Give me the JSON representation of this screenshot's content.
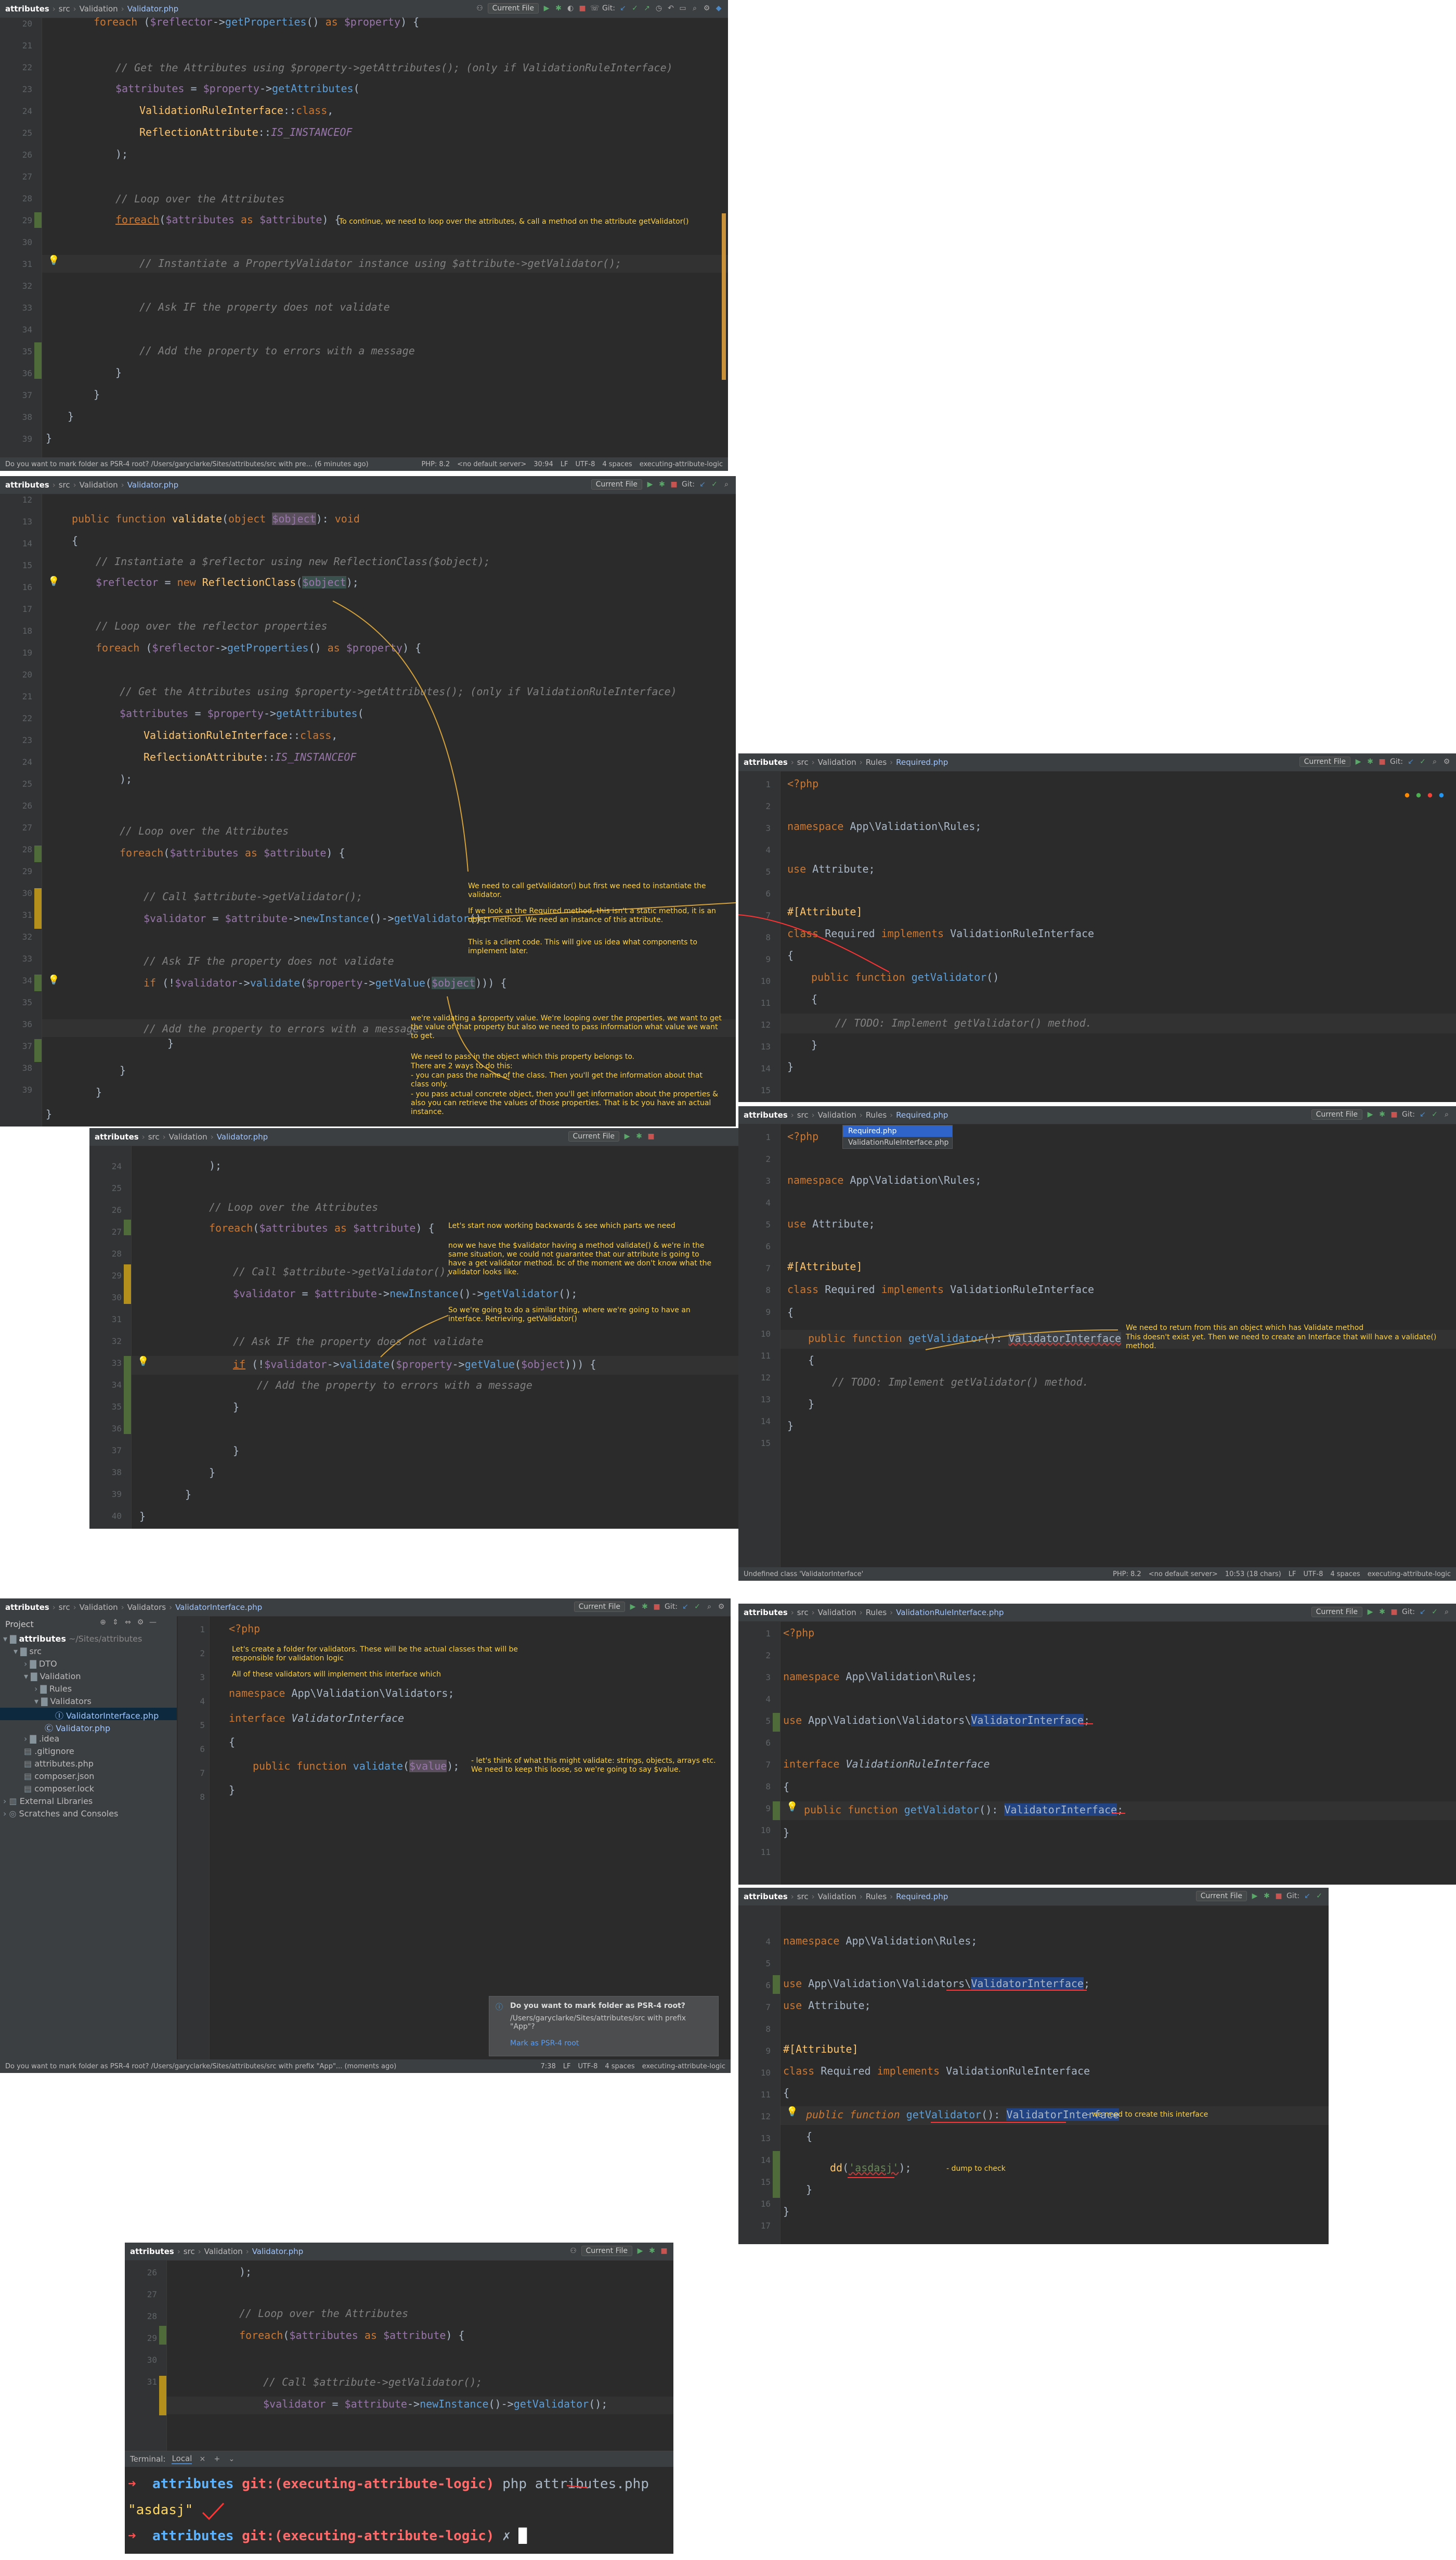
{
  "common": {
    "project": "attributes",
    "src": "src",
    "validation": "Validation",
    "rules": "Rules",
    "validators": "Validators",
    "validator_file": "Validator.php",
    "required_file": "Required.php",
    "vri_file": "ValidationRuleInterface.php",
    "vi_file": "ValidatorInterface.php",
    "run_config": "Current File",
    "git": "Git:",
    "php_version": "PHP: 8.2",
    "servers": "<no default server>",
    "lf": "LF",
    "encoding": "UTF-8",
    "indent": "4 spaces",
    "branch": "executing-attribute-logic"
  },
  "panel1": {
    "lines": [
      "20",
      "21",
      "22",
      "23",
      "24",
      "25",
      "26",
      "27",
      "28",
      "29",
      "30",
      "31",
      "32",
      "33",
      "34",
      "35",
      "36",
      "37",
      "38",
      "39"
    ],
    "note": "To continue, we need to loop over the attributes, & call a method on the attribute getValidator()",
    "status": "Do you want to mark folder as PSR-4 root? /Users/garyclarke/Sites/attributes/src with pre... (6 minutes ago)",
    "pos": "30:94"
  },
  "panel2": {
    "lines": [
      "12",
      "13",
      "14",
      "15",
      "16",
      "17",
      "18",
      "19",
      "20",
      "21",
      "22",
      "23",
      "24",
      "25",
      "26",
      "27",
      "28",
      "29",
      "30",
      "31",
      "32",
      "33",
      "34",
      "35",
      "36",
      "37",
      "38",
      "39"
    ],
    "note1": "We need to call getValidator() but first we need to instantiate the validator.",
    "note2": "If we look at the Required method, this isn't a static method, it is an object method. We need an instance of this attribute.",
    "note3": "This is a client code. This will give us idea what components to implement later.",
    "note4": "we're validating a $property value. We're looping over the properties, we want to get the value of that property but also we need to pass information what value we want to get.",
    "note5": "We need to pass in the object which this property belongs to.",
    "note6": "There are 2 ways to do this:",
    "note7": "- you can pass the name of the class. Then you'll get the information about that class only.",
    "note8": "- you pass actual concrete object, then you'll get information about the properties & also you can retrieve the values of those properties. That is bc you have an actual instance."
  },
  "panel3": {
    "lines": [
      "1",
      "2",
      "3",
      "4",
      "5",
      "6",
      "7",
      "8",
      "9",
      "10",
      "11",
      "12",
      "13",
      "14",
      "15"
    ],
    "status_dummy": ""
  },
  "panel4": {
    "lines": [
      "24",
      "25",
      "26",
      "27",
      "28",
      "29",
      "30",
      "31",
      "32",
      "33",
      "34",
      "35",
      "36",
      "37",
      "38",
      "39",
      "40"
    ],
    "note1": "Let's start now working backwards & see which parts we need",
    "note2": "now we have the $validator having a method validate() & we're in the same situation, we could not guarantee that our attribute is going to have a get validator method. bc of the moment we don't know what the validator looks like.",
    "note3": "So we're going to do a similar thing, where we're going to have an interface. Retrieving, getValidator()"
  },
  "panel5": {
    "lines": [
      "1",
      "2",
      "3",
      "4",
      "5",
      "6",
      "7",
      "8",
      "9",
      "10",
      "11",
      "12",
      "13",
      "14",
      "15"
    ],
    "dd1": "Required.php",
    "dd2": "ValidationRuleInterface.php",
    "note1": "We need to return from this an object which has Validate method",
    "note2": "This doesn't exist yet. Then we need to create an Interface that will have a validate() method.",
    "status": "Undefined class 'ValidatorInterface'",
    "pos": "10:53 (18 chars)"
  },
  "panel6": {
    "lines": [
      "1",
      "2",
      "3",
      "4",
      "5",
      "6",
      "7",
      "8"
    ],
    "project_title": "Project",
    "tree": {
      "root": "attributes",
      "root_path": "~/Sites/attributes",
      "src": "src",
      "dto": "DTO",
      "validation": "Validation",
      "rules": "Rules",
      "validators": "Validators",
      "vi": "ValidatorInterface.php",
      "validator": "Validator.php",
      "idea": ".idea",
      "gitignore": ".gitignore",
      "attributes_php": "attributes.php",
      "composer_json": "composer.json",
      "composer_lock": "composer.lock",
      "ext": "External Libraries",
      "scratch": "Scratches and Consoles"
    },
    "note1": "Let's create a folder for validators. These will be the actual classes that will be responsible for validation logic",
    "note2": "All of these validators will implement this interface which",
    "note3": "- let's think of what this might validate: strings, objects, arrays etc. We need to keep this loose, so we're going to say $value.",
    "popup_title": "Do you want to mark folder as PSR-4 root?",
    "popup_body": "/Users/garyclarke/Sites/attributes/src with prefix \"App\"?",
    "popup_link": "Mark as PSR-4 root",
    "status": "Do you want to mark folder as PSR-4 root? /Users/garyclarke/Sites/attributes/src with prefix \"App\"... (moments ago)",
    "pos": "7:38"
  },
  "panel7": {
    "lines": [
      "1",
      "2",
      "3",
      "4",
      "5",
      "6",
      "7",
      "8",
      "9",
      "10",
      "11"
    ]
  },
  "panel8": {
    "lines": [
      "4",
      "5",
      "6",
      "7",
      "8",
      "9",
      "10",
      "11",
      "12",
      "13",
      "14",
      "15",
      "16",
      "17"
    ],
    "note1": "- we need to create this interface",
    "note2": "- dump to check"
  },
  "panel9": {
    "lines": [
      "26",
      "27",
      "28",
      "29",
      "30",
      "31"
    ],
    "terminal_label": "Terminal:",
    "local_tab": "Local",
    "prompt_dir": "attributes",
    "prompt_git": "git:(executing-attribute-logic)",
    "cmd": "php attributes.php",
    "output": "\"asdasj\"",
    "prompt_end": "✗"
  }
}
